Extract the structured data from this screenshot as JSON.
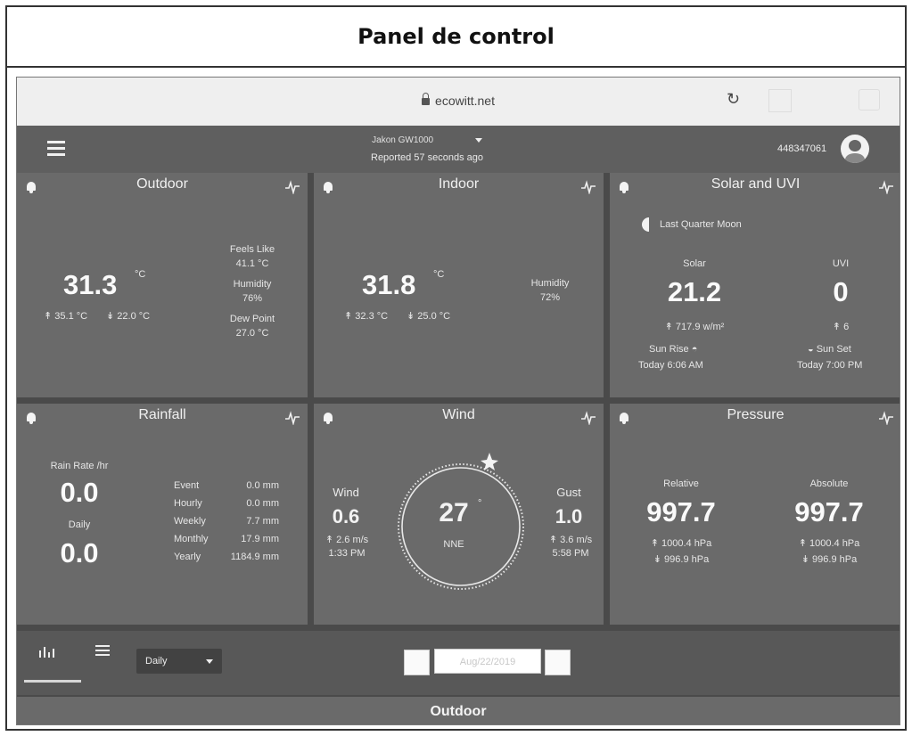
{
  "page_title": "Panel de control",
  "browser": {
    "url": "ecowitt.net"
  },
  "header": {
    "station": "Jakon GW1000",
    "reported": "Reported 57 seconds ago",
    "account": "448347061"
  },
  "outdoor": {
    "title": "Outdoor",
    "temp": "31.3",
    "unit": "°C",
    "high": "↟ 35.1 °C",
    "low": "↡ 22.0 °C",
    "feels_like_label": "Feels Like",
    "feels_like": "41.1 °C",
    "humidity_label": "Humidity",
    "humidity": "76%",
    "dew_point_label": "Dew Point",
    "dew_point": "27.0 °C"
  },
  "indoor": {
    "title": "Indoor",
    "temp": "31.8",
    "unit": "°C",
    "high": "↟ 32.3 °C",
    "low": "↡ 25.0 °C",
    "humidity_label": "Humidity",
    "humidity": "72%"
  },
  "solar": {
    "title": "Solar and UVI",
    "moon": "Last Quarter Moon",
    "solar_label": "Solar",
    "solar": "21.2",
    "solar_max": "↟ 717.9 w/m²",
    "uvi_label": "UVI",
    "uvi": "0",
    "uvi_max": "↟ 6",
    "sunrise_label": "Sun Rise",
    "sunrise": "Today 6:06 AM",
    "sunset_label": "Sun Set",
    "sunset": "Today 7:00 PM"
  },
  "rainfall": {
    "title": "Rainfall",
    "rate_label": "Rain Rate /hr",
    "rate": "0.0",
    "daily_label": "Daily",
    "daily": "0.0",
    "rows": [
      {
        "label": "Event",
        "value": "0.0 mm"
      },
      {
        "label": "Hourly",
        "value": "0.0 mm"
      },
      {
        "label": "Weekly",
        "value": "7.7 mm"
      },
      {
        "label": "Monthly",
        "value": "17.9 mm"
      },
      {
        "label": "Yearly",
        "value": "1184.9 mm"
      }
    ]
  },
  "wind": {
    "title": "Wind",
    "wind_label": "Wind",
    "wind": "0.6",
    "wind_max": "↟ 2.6 m/s",
    "wind_time": "1:33 PM",
    "direction": "27",
    "deg": "°",
    "direction_name": "NNE",
    "gust_label": "Gust",
    "gust": "1.0",
    "gust_max": "↟ 3.6 m/s",
    "gust_time": "5:58 PM"
  },
  "pressure": {
    "title": "Pressure",
    "relative_label": "Relative",
    "relative": "997.7",
    "relative_max": "↟ 1000.4 hPa",
    "relative_min": "↡ 996.9 hPa",
    "absolute_label": "Absolute",
    "absolute": "997.7",
    "absolute_max": "↟ 1000.4 hPa",
    "absolute_min": "↡ 996.9 hPa"
  },
  "toolbar": {
    "period": "Daily",
    "date": "Aug/22/2019"
  },
  "section_label": "Outdoor"
}
